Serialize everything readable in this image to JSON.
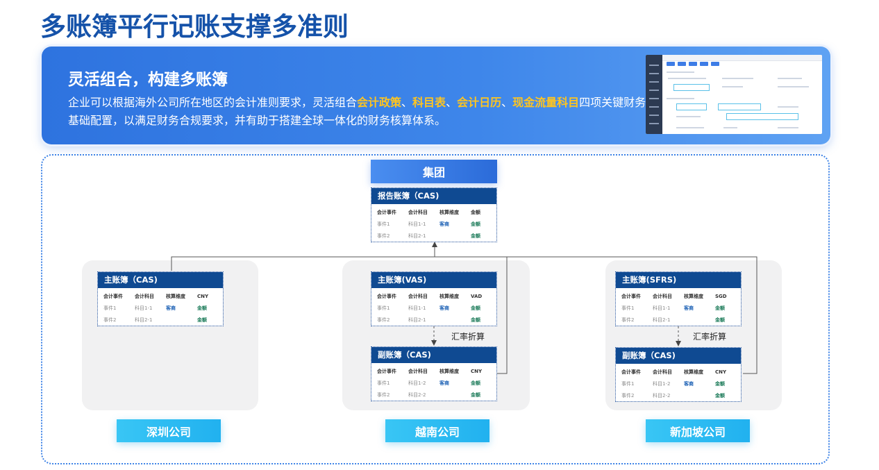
{
  "page": {
    "title": "多账簿平行记账支撑多准则"
  },
  "banner": {
    "heading": "灵活组合，构建多账簿",
    "text_parts": [
      {
        "text": "企业可以根据海外公司所在地区的会计准则要求，灵活组合",
        "highlight": false
      },
      {
        "text": "会计政策",
        "highlight": true
      },
      {
        "text": "、",
        "highlight": false
      },
      {
        "text": "科目表",
        "highlight": true
      },
      {
        "text": "、",
        "highlight": false
      },
      {
        "text": "会计日历",
        "highlight": true
      },
      {
        "text": "、",
        "highlight": false
      },
      {
        "text": "现金流量科目",
        "highlight": true
      },
      {
        "text": "四项关键财务基础配置，以满足财务合规要求，并有助于搭建全球一体化的财务核算体系。",
        "highlight": false
      }
    ],
    "highlight_color": "#ffc51f"
  },
  "diagram": {
    "group_label": "集团",
    "columns": [
      "会计事件",
      "会计科目",
      "核算维度",
      "金额"
    ],
    "report_ledger": {
      "title": "报告账簿（CAS)",
      "currency": "金额",
      "rows": [
        {
          "event": "事件1",
          "account": "科目1-1",
          "dimension": "客商",
          "amount": "金额"
        },
        {
          "event": "事件2",
          "account": "科目2-1",
          "dimension": "",
          "amount": "金额"
        }
      ]
    },
    "fx_label": "汇率折算",
    "companies": [
      {
        "name": "深圳公司",
        "main_ledger": {
          "title": "主账簿（CAS)",
          "currency": "CNY",
          "rows": [
            {
              "event": "事件1",
              "account": "科目1-1",
              "dimension": "客商",
              "amount": "金额"
            },
            {
              "event": "事件2",
              "account": "科目2-1",
              "dimension": "",
              "amount": "金额"
            }
          ]
        }
      },
      {
        "name": "越南公司",
        "main_ledger": {
          "title": "主账簿(VAS)",
          "currency": "VAD",
          "rows": [
            {
              "event": "事件1",
              "account": "科目1-1",
              "dimension": "客商",
              "amount": "金额"
            },
            {
              "event": "事件2",
              "account": "科目2-1",
              "dimension": "",
              "amount": "金额"
            }
          ]
        },
        "sub_ledger": {
          "title": "副账簿（CAS)",
          "currency": "CNY",
          "rows": [
            {
              "event": "事件1",
              "account": "科目1-2",
              "dimension": "客商",
              "amount": "金额"
            },
            {
              "event": "事件2",
              "account": "科目2-2",
              "dimension": "",
              "amount": "金额"
            }
          ]
        }
      },
      {
        "name": "新加坡公司",
        "main_ledger": {
          "title": "主账簿(SFRS)",
          "currency": "SGD",
          "rows": [
            {
              "event": "事件1",
              "account": "科目1-1",
              "dimension": "客商",
              "amount": "金额"
            },
            {
              "event": "事件2",
              "account": "科目2-1",
              "dimension": "",
              "amount": "金额"
            }
          ]
        },
        "sub_ledger": {
          "title": "副账簿（CAS)",
          "currency": "CNY",
          "rows": [
            {
              "event": "事件1",
              "account": "科目1-2",
              "dimension": "客商",
              "amount": "金额"
            },
            {
              "event": "事件2",
              "account": "科目2-2",
              "dimension": "",
              "amount": "金额"
            }
          ]
        }
      }
    ]
  }
}
